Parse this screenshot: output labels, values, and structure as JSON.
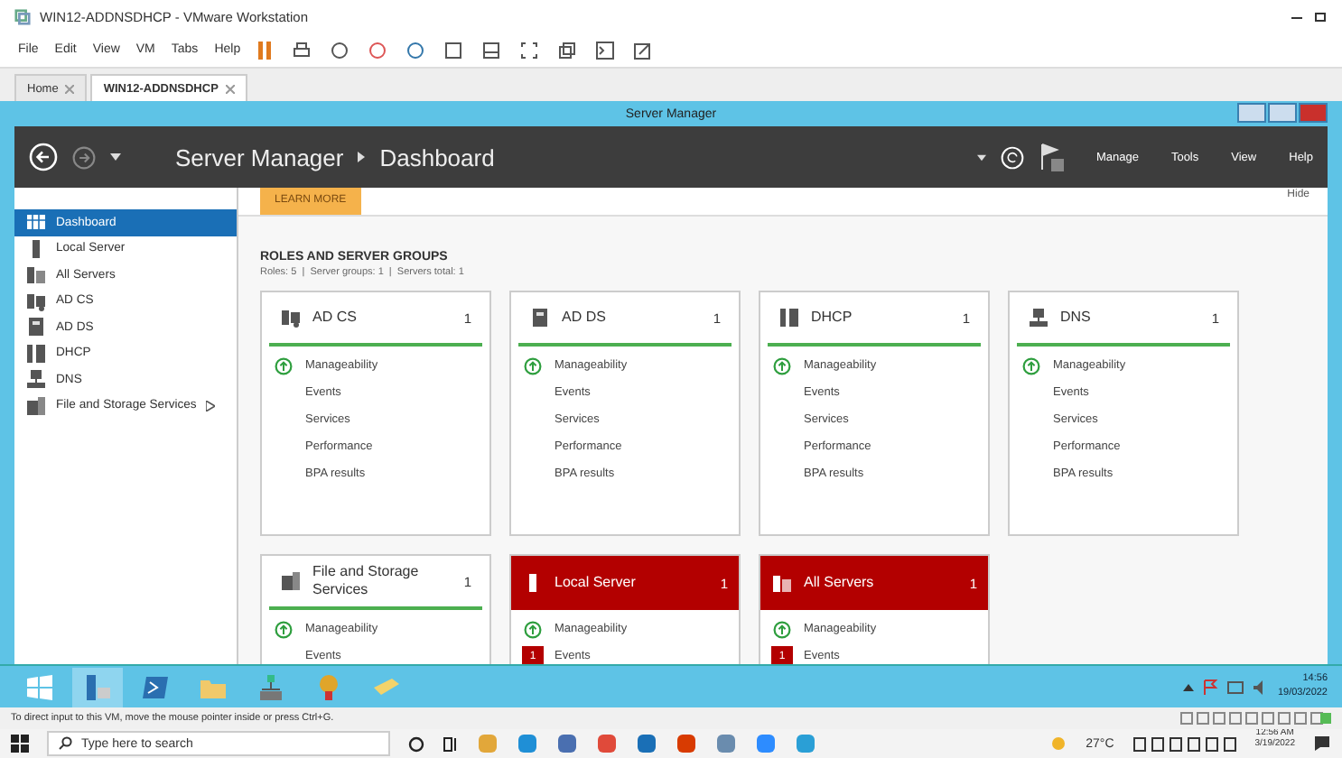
{
  "vmware": {
    "title": "WIN12-ADDNSDHCP - VMware Workstation",
    "menu": [
      "File",
      "Edit",
      "View",
      "VM",
      "Tabs",
      "Help"
    ],
    "tabs": [
      {
        "label": "Home",
        "selected": false
      },
      {
        "label": "WIN12-ADDNSDHCP",
        "selected": true
      }
    ],
    "status_text": "To direct input to this VM, move the mouse pointer inside or press Ctrl+G."
  },
  "server_manager": {
    "title": "Server Manager",
    "breadcrumb": [
      "Server Manager",
      "Dashboard"
    ],
    "header_menu": [
      "Manage",
      "Tools",
      "View",
      "Help"
    ],
    "sidebar": [
      {
        "label": "Dashboard",
        "kind": "dashboard",
        "selected": true,
        "submenu": false
      },
      {
        "label": "Local Server",
        "kind": "server",
        "selected": false,
        "submenu": false
      },
      {
        "label": "All Servers",
        "kind": "servers",
        "selected": false,
        "submenu": false
      },
      {
        "label": "AD CS",
        "kind": "adcs",
        "selected": false,
        "submenu": false
      },
      {
        "label": "AD DS",
        "kind": "adds",
        "selected": false,
        "submenu": false
      },
      {
        "label": "DHCP",
        "kind": "dhcp",
        "selected": false,
        "submenu": false
      },
      {
        "label": "DNS",
        "kind": "dns",
        "selected": false,
        "submenu": false
      },
      {
        "label": "File and Storage Services",
        "kind": "files",
        "selected": false,
        "submenu": true
      }
    ],
    "learn_more": "LEARN MORE",
    "hide": "Hide",
    "roles_heading": "ROLES AND SERVER GROUPS",
    "roles_summary": "Roles: 5  |  Server groups: 1  |  Servers total: 1",
    "tiles": [
      {
        "name": "AD CS",
        "kind": "adcs",
        "count": "1",
        "alert": false,
        "rows": [
          {
            "label": "Manageability",
            "up": true
          },
          {
            "label": "Events",
            "up": false
          },
          {
            "label": "Services",
            "up": false
          },
          {
            "label": "Performance",
            "up": false
          },
          {
            "label": "BPA results",
            "up": false
          }
        ]
      },
      {
        "name": "AD DS",
        "kind": "adds",
        "count": "1",
        "alert": false,
        "rows": [
          {
            "label": "Manageability",
            "up": true
          },
          {
            "label": "Events",
            "up": false
          },
          {
            "label": "Services",
            "up": false
          },
          {
            "label": "Performance",
            "up": false
          },
          {
            "label": "BPA results",
            "up": false
          }
        ]
      },
      {
        "name": "DHCP",
        "kind": "dhcp",
        "count": "1",
        "alert": false,
        "rows": [
          {
            "label": "Manageability",
            "up": true
          },
          {
            "label": "Events",
            "up": false
          },
          {
            "label": "Services",
            "up": false
          },
          {
            "label": "Performance",
            "up": false
          },
          {
            "label": "BPA results",
            "up": false
          }
        ]
      },
      {
        "name": "DNS",
        "kind": "dns",
        "count": "1",
        "alert": false,
        "rows": [
          {
            "label": "Manageability",
            "up": true
          },
          {
            "label": "Events",
            "up": false
          },
          {
            "label": "Services",
            "up": false
          },
          {
            "label": "Performance",
            "up": false
          },
          {
            "label": "BPA results",
            "up": false
          }
        ]
      },
      {
        "name": "File and Storage Services",
        "kind": "files",
        "count": "1",
        "alert": false,
        "rows": [
          {
            "label": "Manageability",
            "up": true
          },
          {
            "label": "Events",
            "up": false
          }
        ]
      },
      {
        "name": "Local Server",
        "kind": "server",
        "count": "1",
        "alert": true,
        "rows": [
          {
            "label": "Manageability",
            "up": true
          },
          {
            "label": "Events",
            "up": false,
            "badge": "1"
          }
        ]
      },
      {
        "name": "All Servers",
        "kind": "servers",
        "count": "1",
        "alert": true,
        "rows": [
          {
            "label": "Manageability",
            "up": true
          },
          {
            "label": "Events",
            "up": false,
            "badge": "1"
          }
        ]
      }
    ]
  },
  "guest_taskbar": {
    "time": "14:56",
    "date": "19/03/2022"
  },
  "host_taskbar": {
    "search_placeholder": "Type here to search",
    "weather": "27°C",
    "time": "12:56 AM",
    "date": "3/19/2022"
  }
}
